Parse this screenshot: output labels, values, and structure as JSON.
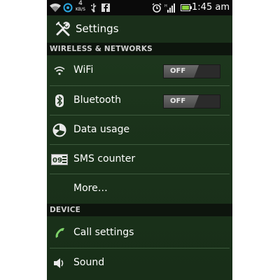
{
  "status_bar": {
    "time": "1:45 am",
    "speed_value": "4",
    "speed_unit": "KB/S",
    "icons": [
      "wifi-icon",
      "sync-icon",
      "usb-icon",
      "facebook-icon",
      "alarm-icon",
      "signal-icon",
      "battery-icon"
    ]
  },
  "title_bar": {
    "title": "Settings",
    "icon": "wrench-screwdriver-icon"
  },
  "sections": [
    {
      "header": "WIRELESS & NETWORKS",
      "items": [
        {
          "label": "WiFi",
          "icon": "wifi-icon",
          "toggle": "OFF"
        },
        {
          "label": "Bluetooth",
          "icon": "bluetooth-icon",
          "toggle": "OFF"
        },
        {
          "label": "Data usage",
          "icon": "data-usage-icon"
        },
        {
          "label": "SMS counter",
          "icon": "sms-counter-icon",
          "icon_text": "09"
        },
        {
          "label": "More…"
        }
      ]
    },
    {
      "header": "DEVICE",
      "items": [
        {
          "label": "Call settings",
          "icon": "phone-icon"
        },
        {
          "label": "Sound",
          "icon": "speaker-icon"
        }
      ]
    }
  ],
  "colors": {
    "background": "#1c351c",
    "section_header": "#0d150d",
    "toggle_off": "#4a4a4a"
  }
}
